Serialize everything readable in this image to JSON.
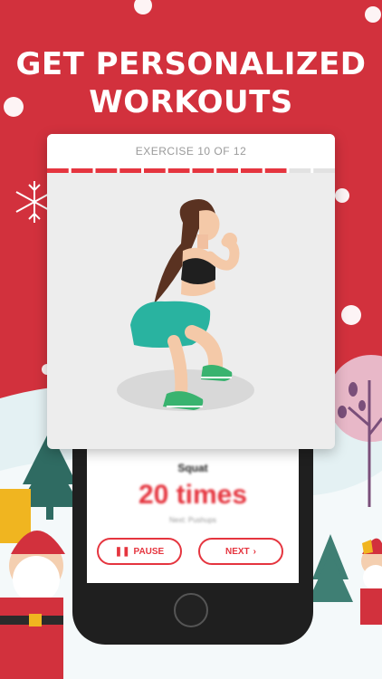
{
  "headline": {
    "line1": "GET PERSONALIZED",
    "line2": "WORKOUTS"
  },
  "exercise_card": {
    "title": "EXERCISE 10 OF 12",
    "progress": {
      "current": 10,
      "total": 12
    },
    "illustration": "woman-squat-illustration"
  },
  "phone_screen": {
    "exercise_name": "Squat",
    "count": "20 times",
    "next_label": "Next: Pushups",
    "pause_label": "PAUSE",
    "next_button_label": "NEXT"
  },
  "colors": {
    "background": "#d2313d",
    "accent": "#e5353f",
    "card": "#ededed"
  },
  "icons": [
    "pause-icon",
    "chevron-right-icon",
    "snowflake-icon",
    "santa-decoration",
    "christmas-tree-icon"
  ]
}
